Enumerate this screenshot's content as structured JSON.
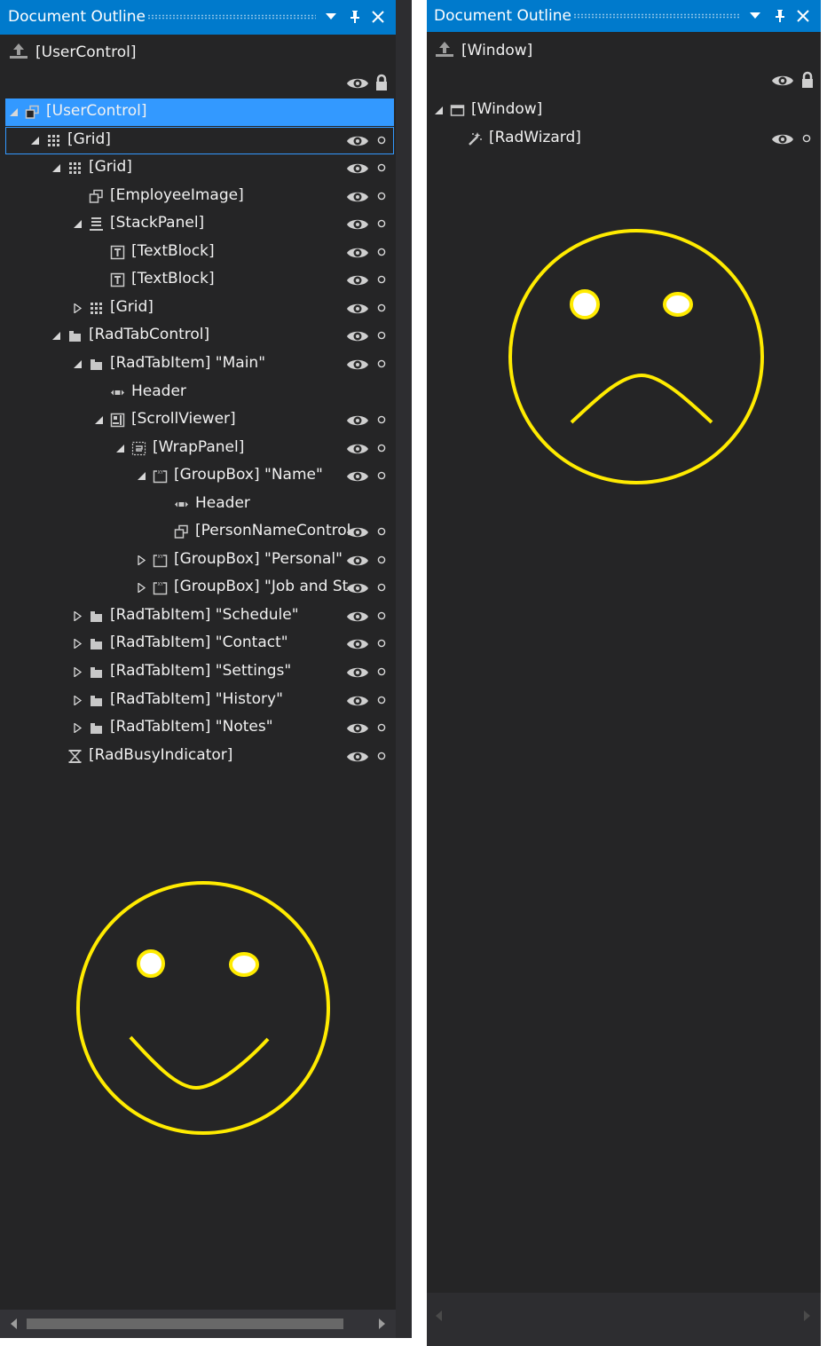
{
  "left_panel": {
    "title": "Document Outline",
    "root": "[UserControl]",
    "rows": [
      {
        "depth": 0,
        "arrow": "expanded",
        "icon": "usercontrol-icon",
        "label": "[UserControl]",
        "eye": false,
        "dot": false,
        "state": "selected"
      },
      {
        "depth": 1,
        "arrow": "expanded",
        "icon": "grid-icon",
        "label": "[Grid]",
        "eye": true,
        "dot": true,
        "state": "focused"
      },
      {
        "depth": 2,
        "arrow": "expanded",
        "icon": "grid-icon",
        "label": "[Grid]",
        "eye": true,
        "dot": true
      },
      {
        "depth": 3,
        "arrow": "none",
        "icon": "usercontrol-icon",
        "label": "[EmployeeImage]",
        "eye": true,
        "dot": true
      },
      {
        "depth": 3,
        "arrow": "expanded",
        "icon": "stackpanel-icon",
        "label": "[StackPanel]",
        "eye": true,
        "dot": true
      },
      {
        "depth": 4,
        "arrow": "none",
        "icon": "textblock-icon",
        "label": "[TextBlock]",
        "eye": true,
        "dot": true
      },
      {
        "depth": 4,
        "arrow": "none",
        "icon": "textblock-icon",
        "label": "[TextBlock]",
        "eye": true,
        "dot": true
      },
      {
        "depth": 3,
        "arrow": "collapsed",
        "icon": "grid-icon",
        "label": "[Grid]",
        "eye": true,
        "dot": true
      },
      {
        "depth": 2,
        "arrow": "expanded",
        "icon": "folder-icon",
        "label": "[RadTabControl]",
        "eye": true,
        "dot": true
      },
      {
        "depth": 3,
        "arrow": "expanded",
        "icon": "folder-icon",
        "label": "[RadTabItem] \"Main\"",
        "eye": true,
        "dot": true
      },
      {
        "depth": 4,
        "arrow": "none",
        "icon": "header-icon",
        "label": "Header",
        "eye": false,
        "dot": false
      },
      {
        "depth": 4,
        "arrow": "expanded",
        "icon": "scrollviewer-icon",
        "label": "[ScrollViewer]",
        "eye": true,
        "dot": true
      },
      {
        "depth": 5,
        "arrow": "expanded",
        "icon": "wrappanel-icon",
        "label": "[WrapPanel]",
        "eye": true,
        "dot": true
      },
      {
        "depth": 6,
        "arrow": "expanded",
        "icon": "groupbox-icon",
        "label": "[GroupBox] \"Name\"",
        "eye": true,
        "dot": true
      },
      {
        "depth": 7,
        "arrow": "none",
        "icon": "header-icon",
        "label": "Header",
        "eye": false,
        "dot": false
      },
      {
        "depth": 7,
        "arrow": "none",
        "icon": "usercontrol-icon",
        "label": "[PersonNameControl]",
        "eye": true,
        "dot": true,
        "clip": true
      },
      {
        "depth": 6,
        "arrow": "collapsed",
        "icon": "groupbox-icon",
        "label": "[GroupBox] \"Personal\"",
        "eye": true,
        "dot": true
      },
      {
        "depth": 6,
        "arrow": "collapsed",
        "icon": "groupbox-icon",
        "label": "[GroupBox] \"Job and Status\"",
        "eye": true,
        "dot": true,
        "clip": true
      },
      {
        "depth": 3,
        "arrow": "collapsed",
        "icon": "folder-icon",
        "label": "[RadTabItem] \"Schedule\"",
        "eye": true,
        "dot": true
      },
      {
        "depth": 3,
        "arrow": "collapsed",
        "icon": "folder-icon",
        "label": "[RadTabItem] \"Contact\"",
        "eye": true,
        "dot": true
      },
      {
        "depth": 3,
        "arrow": "collapsed",
        "icon": "folder-icon",
        "label": "[RadTabItem] \"Settings\"",
        "eye": true,
        "dot": true
      },
      {
        "depth": 3,
        "arrow": "collapsed",
        "icon": "folder-icon",
        "label": "[RadTabItem] \"History\"",
        "eye": true,
        "dot": true
      },
      {
        "depth": 3,
        "arrow": "collapsed",
        "icon": "folder-icon",
        "label": "[RadTabItem] \"Notes\"",
        "eye": true,
        "dot": true
      },
      {
        "depth": 2,
        "arrow": "none",
        "icon": "busyindicator-icon",
        "label": "[RadBusyIndicator]",
        "eye": true,
        "dot": true
      }
    ],
    "smiley": "happy-face"
  },
  "right_panel": {
    "title": "Document Outline",
    "root": "[Window]",
    "rows": [
      {
        "depth": 0,
        "arrow": "expanded",
        "icon": "window-icon",
        "label": "[Window]",
        "eye": false,
        "dot": false
      },
      {
        "depth": 1,
        "arrow": "none",
        "icon": "wizard-icon",
        "label": "[RadWizard]",
        "eye": true,
        "dot": true
      }
    ],
    "smiley": "sad-face"
  },
  "colors": {
    "title_bar": "#007acc",
    "panel_bg": "#252526",
    "selection": "#3399ff",
    "text": "#f1f1f1",
    "icon": "#c8c8c8",
    "smiley": "#ffeb00"
  }
}
